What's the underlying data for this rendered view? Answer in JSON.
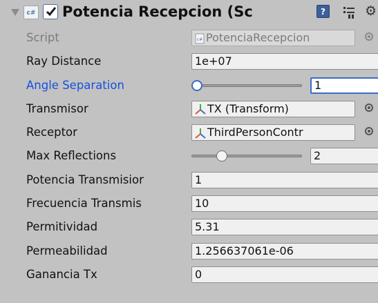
{
  "component": {
    "title": "Potencia Recepcion (Sc",
    "enabled": true,
    "script_icon": "csharp-script-icon",
    "icons": [
      "help-icon",
      "preset-icon",
      "gear-icon"
    ]
  },
  "rows": {
    "script": {
      "label": "Script",
      "value": "PotenciaRecepcion"
    },
    "ray_distance": {
      "label": "Ray Distance",
      "value": "1e+07"
    },
    "angle_separation": {
      "label": "Angle Separation",
      "value": "1",
      "slider_fraction": 0.0
    },
    "transmisor": {
      "label": "Transmisor",
      "value": "TX (Transform)"
    },
    "receptor": {
      "label": "Receptor",
      "value": "ThirdPersonContr"
    },
    "max_reflections": {
      "label": "Max Reflections",
      "value": "2",
      "slider_fraction": 0.25
    },
    "potencia_transmision": {
      "label": "Potencia Transmisior",
      "value": "1"
    },
    "frecuencia_transmision": {
      "label": "Frecuencia Transmis",
      "value": "10"
    },
    "permitividad": {
      "label": "Permitividad",
      "value": "5.31"
    },
    "permeabilidad": {
      "label": "Permeabilidad",
      "value": "1.256637061e-06"
    },
    "ganancia_tx": {
      "label": "Ganancia Tx",
      "value": "0"
    }
  },
  "colors": {
    "background": "#c2c2c2",
    "focused_label": "#1650e0",
    "focus_outline": "#3a6cc5"
  }
}
